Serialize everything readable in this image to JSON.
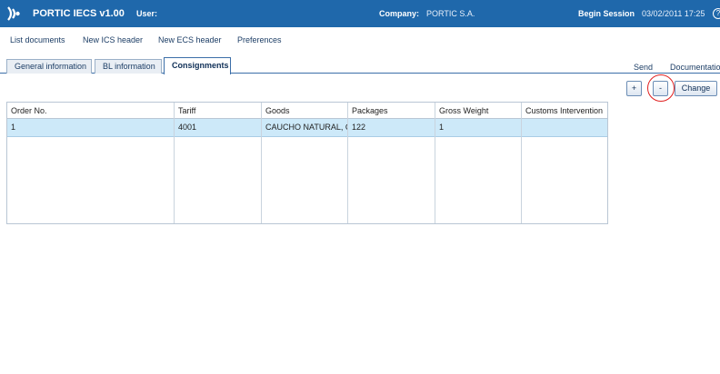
{
  "header": {
    "app_title": "PORTIC IECS v1.00",
    "user_label": "User:",
    "company_label": "Company:",
    "company_value": "PORTIC  S.A.",
    "session_label": "Begin Session",
    "session_value": "03/02/2011 17:25",
    "brand_color": "#1f68ab"
  },
  "menu": {
    "items": [
      "List documents",
      "New ICS header",
      "New ECS header",
      "Preferences"
    ]
  },
  "tabs": {
    "items": [
      "General information",
      "BL information",
      "Consignments"
    ],
    "active": "Consignments"
  },
  "links": {
    "send": "Send",
    "documentation": "Documentation"
  },
  "toolbar": {
    "add_label": "+",
    "remove_label": "-",
    "change_label": "Change"
  },
  "grid": {
    "columns": [
      "Order No.",
      "Tariff",
      "Goods",
      "Packages",
      "Gross Weight",
      "Customs Intervention"
    ],
    "rows": [
      [
        "1",
        "4001",
        "CAUCHO NATURAL, CI",
        "122",
        "1",
        ""
      ]
    ],
    "selected_row_color": "#cde9f9"
  }
}
